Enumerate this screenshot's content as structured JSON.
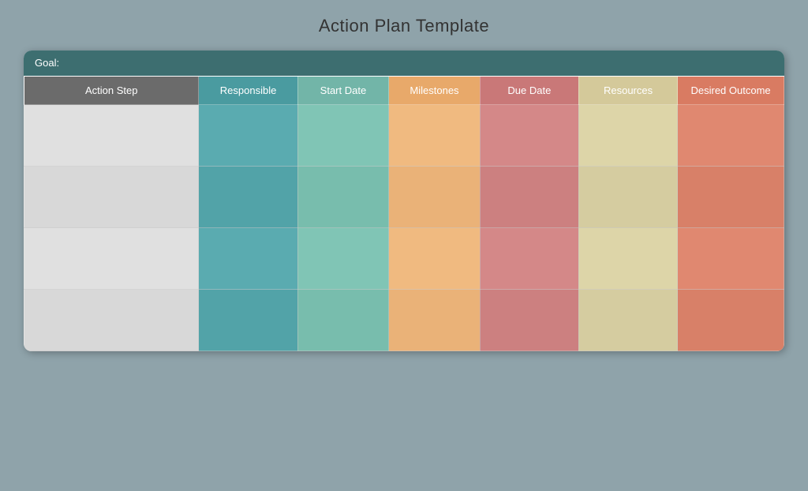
{
  "page": {
    "title": "Action Plan Template"
  },
  "goal_label": "Goal:",
  "columns": [
    {
      "id": "action-step",
      "label": "Action Step",
      "class_th": "th-action-step",
      "class_td": "td-action-step",
      "col": "col-action"
    },
    {
      "id": "responsible",
      "label": "Responsible",
      "class_th": "th-responsible",
      "class_td": "td-responsible",
      "col": "col-resp"
    },
    {
      "id": "start-date",
      "label": "Start Date",
      "class_th": "th-start-date",
      "class_td": "td-start-date",
      "col": "col-start"
    },
    {
      "id": "milestones",
      "label": "Milestones",
      "class_th": "th-milestones",
      "class_td": "td-milestones",
      "col": "col-mile"
    },
    {
      "id": "due-date",
      "label": "Due Date",
      "class_th": "th-due-date",
      "class_td": "td-due-date",
      "col": "col-due"
    },
    {
      "id": "resources",
      "label": "Resources",
      "class_th": "th-resources",
      "class_td": "td-resources",
      "col": "col-res"
    },
    {
      "id": "desired-outcome",
      "label": "Desired Outcome",
      "class_th": "th-desired-outcome",
      "class_td": "td-desired-outcome",
      "col": "col-desired"
    }
  ],
  "rows": [
    {
      "odd": true
    },
    {
      "odd": false
    },
    {
      "odd": true
    },
    {
      "odd": false
    }
  ]
}
